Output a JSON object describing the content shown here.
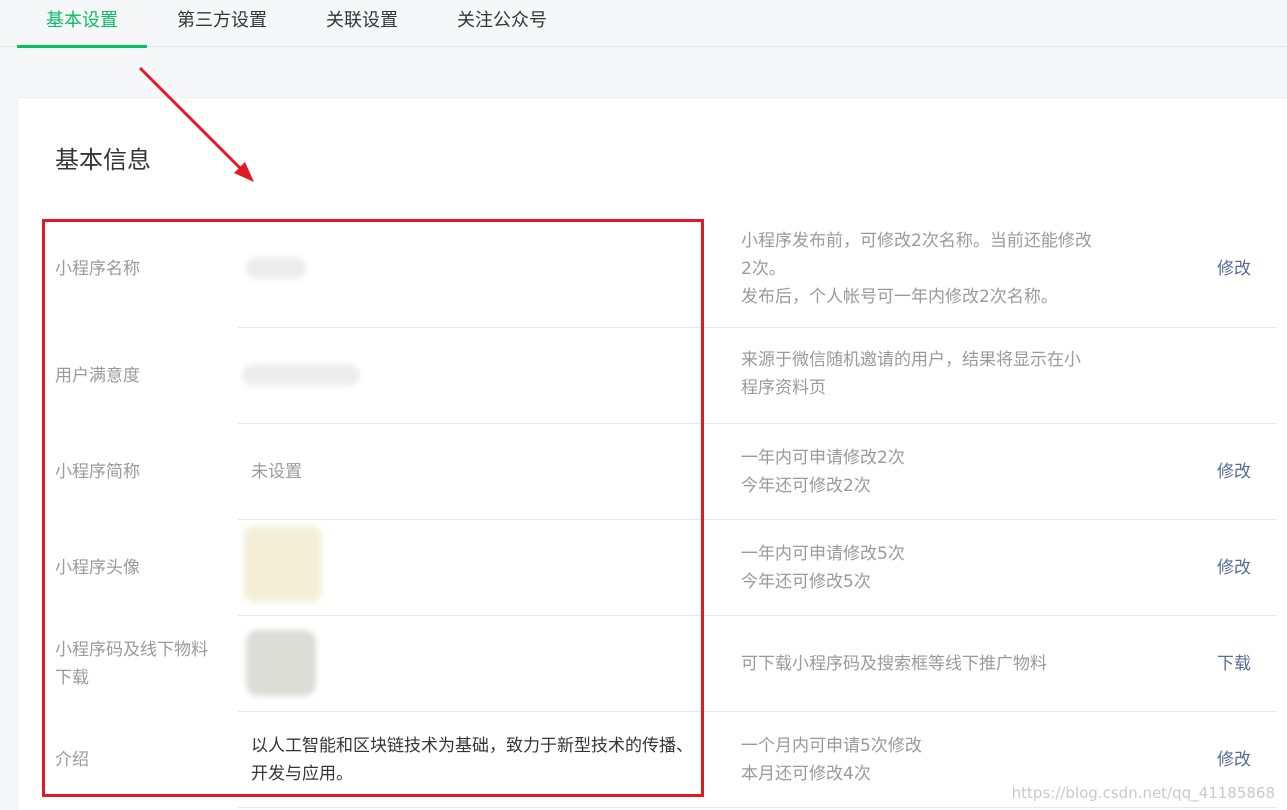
{
  "tabs": [
    {
      "label": "基本设置",
      "active": true
    },
    {
      "label": "第三方设置",
      "active": false
    },
    {
      "label": "关联设置",
      "active": false
    },
    {
      "label": "关注公众号",
      "active": false
    }
  ],
  "section": {
    "title": "基本信息"
  },
  "rows": [
    {
      "label": "小程序名称",
      "value": "",
      "desc_lines": [
        "小程序发布前，可修改2次名称。当前还能修改",
        "2次。",
        "发布后，个人帐号可一年内修改2次名称。"
      ],
      "action": "修改"
    },
    {
      "label": "用户满意度",
      "value": "",
      "desc_lines": [
        "来源于微信随机邀请的用户，结果将显示在小",
        "程序资料页"
      ],
      "action": ""
    },
    {
      "label": "小程序简称",
      "value": "未设置",
      "desc_lines": [
        "一年内可申请修改2次",
        "今年还可修改2次"
      ],
      "action": "修改"
    },
    {
      "label": "小程序头像",
      "value": "",
      "desc_lines": [
        "一年内可申请修改5次",
        "今年还可修改5次"
      ],
      "action": "修改"
    },
    {
      "label_lines": [
        "小程序码及线下物料",
        "下载"
      ],
      "value": "",
      "desc_lines": [
        "可下载小程序码及搜索框等线下推广物料"
      ],
      "action": "下载"
    },
    {
      "label": "介绍",
      "value_lines": [
        "以人工智能和区块链技术为基础，致力于新型技术的传播、",
        "开发与应用。"
      ],
      "desc_lines": [
        "一个月内可申请5次修改",
        "本月还可修改4次"
      ],
      "action": "修改"
    }
  ],
  "watermark": "https://blog.csdn.net/qq_41185868",
  "colors": {
    "accent": "#07c160",
    "link": "#576b95",
    "annotation": "#e21b23"
  }
}
